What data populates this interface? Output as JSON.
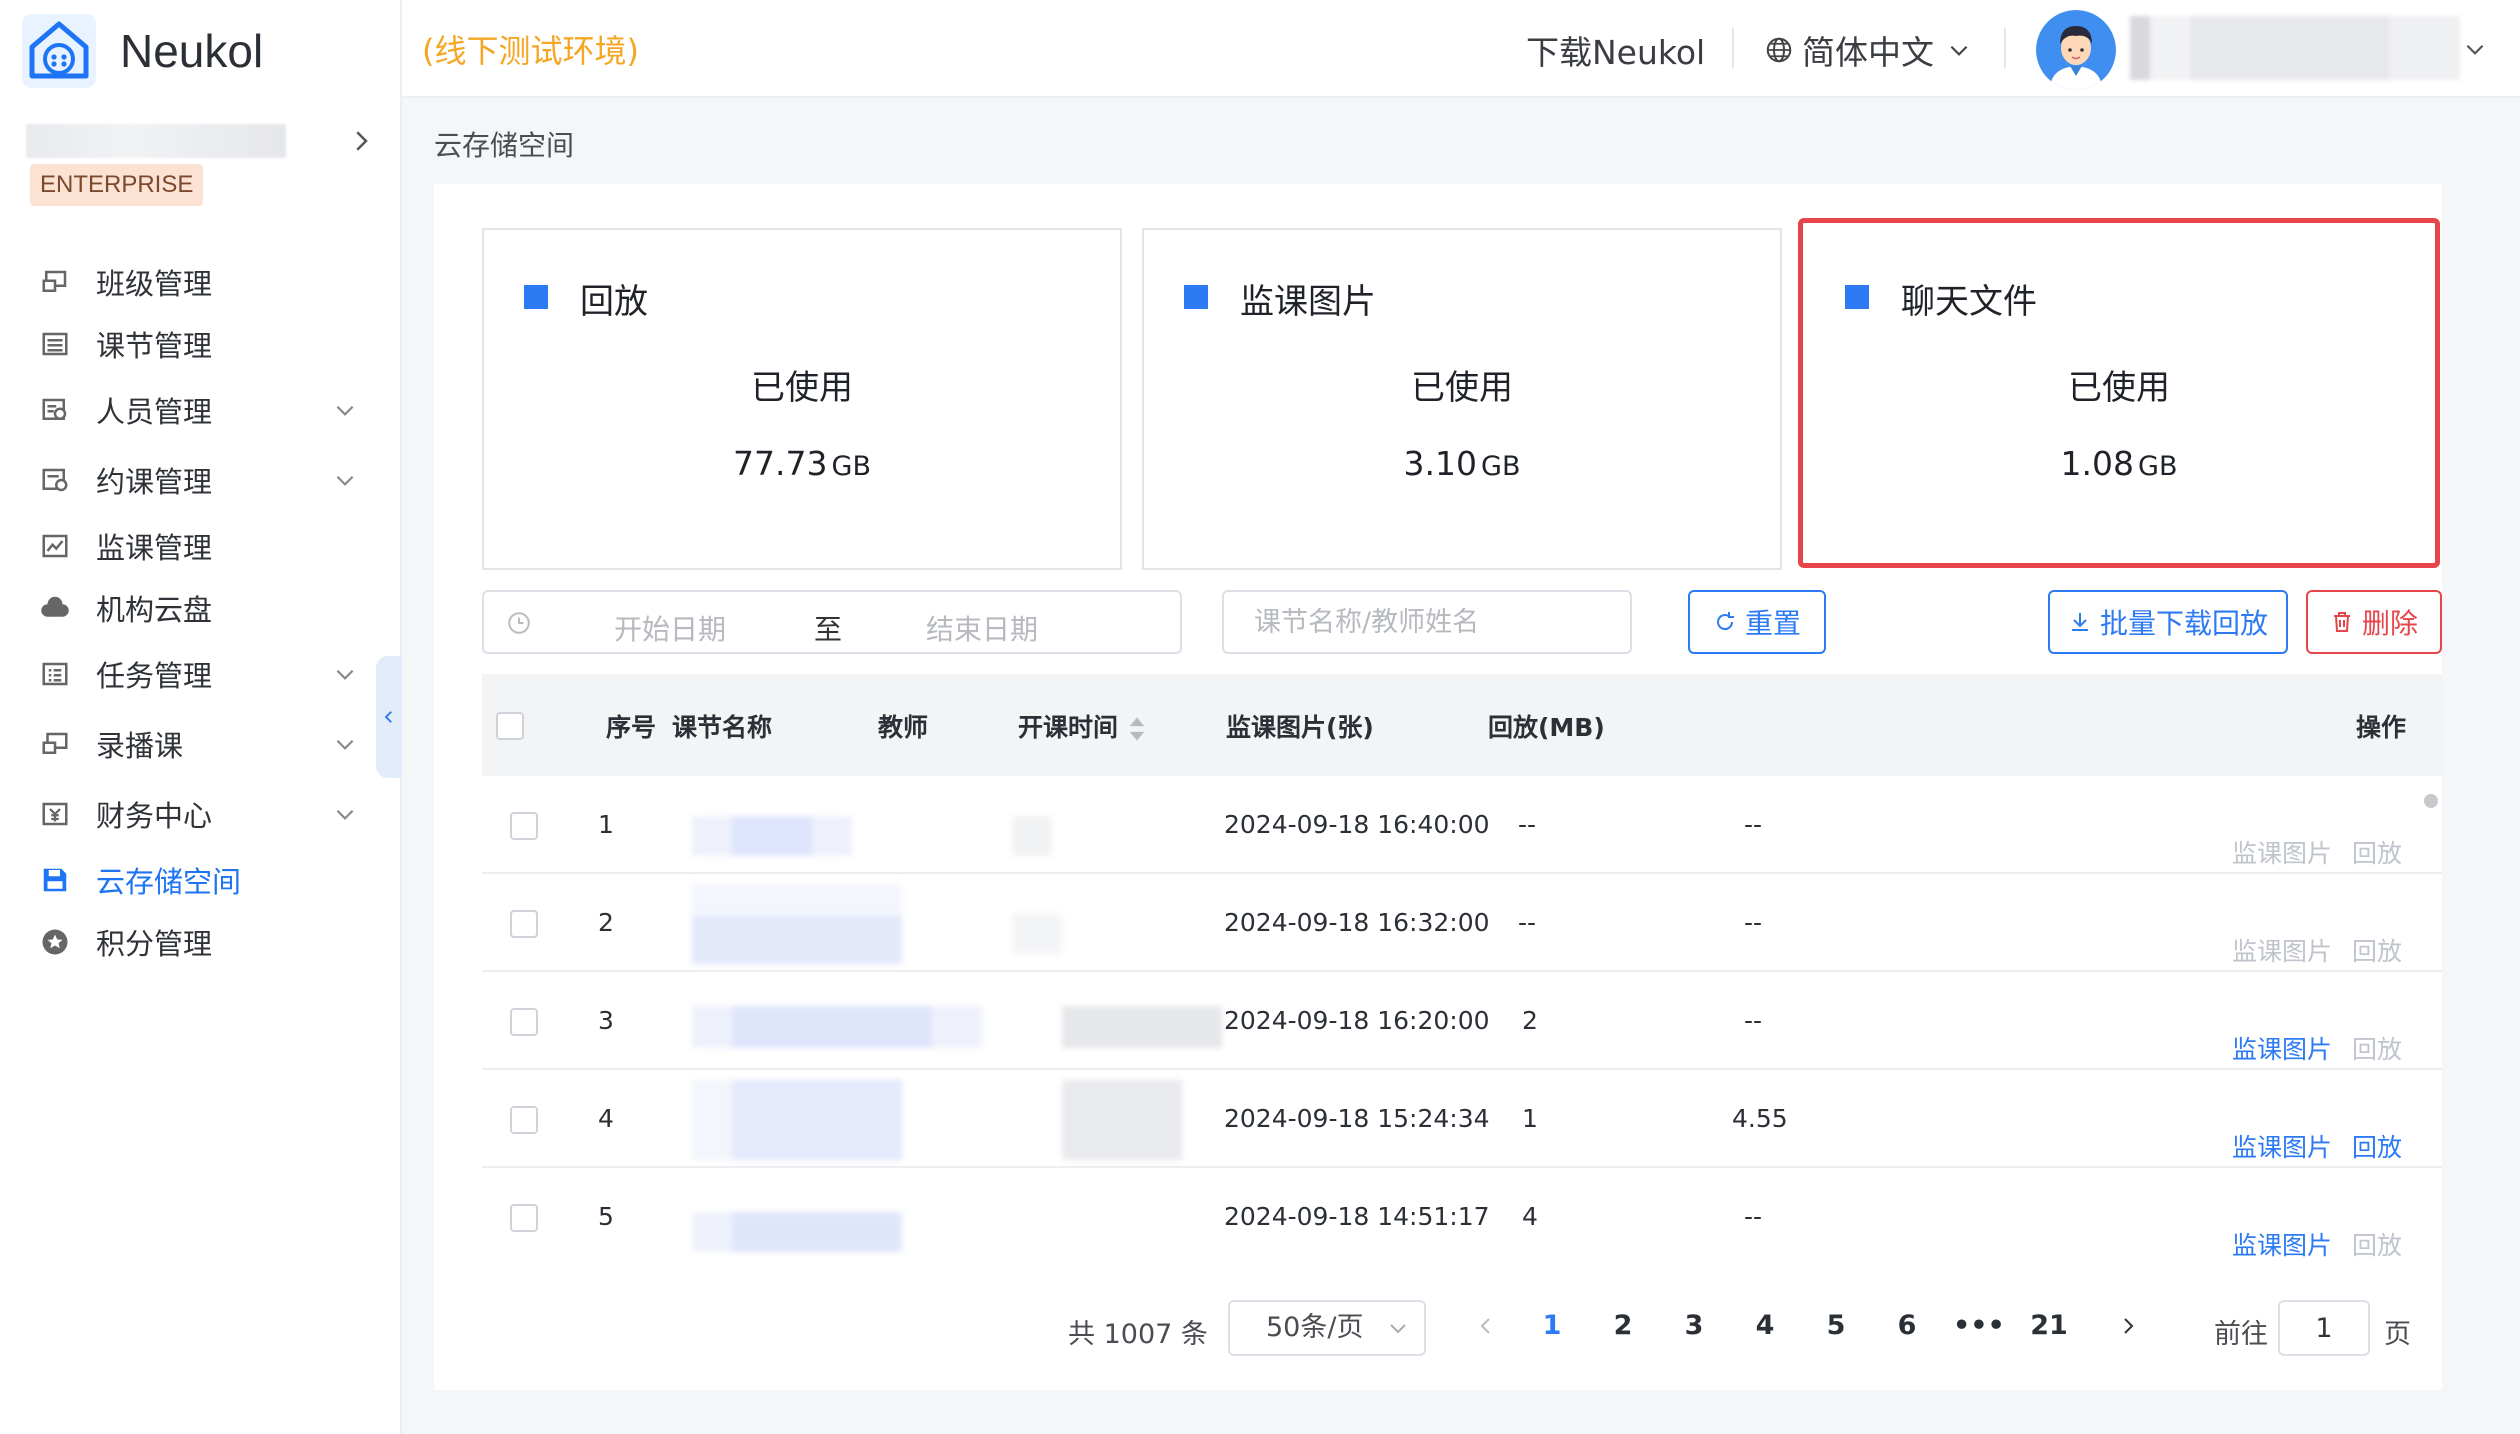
{
  "brand": {
    "name": "Neukol",
    "plan_badge": "ENTERPRISE"
  },
  "sidebar": {
    "items": [
      {
        "label": "班级管理",
        "icon": "class-icon",
        "expandable": false,
        "active": false
      },
      {
        "label": "课节管理",
        "icon": "lesson-list-icon",
        "expandable": false,
        "active": false
      },
      {
        "label": "人员管理",
        "icon": "people-icon",
        "expandable": true,
        "active": false
      },
      {
        "label": "约课管理",
        "icon": "booking-icon",
        "expandable": true,
        "active": false
      },
      {
        "label": "监课管理",
        "icon": "monitor-chart-icon",
        "expandable": false,
        "active": false
      },
      {
        "label": "机构云盘",
        "icon": "cloud-icon",
        "expandable": false,
        "active": false
      },
      {
        "label": "任务管理",
        "icon": "task-icon",
        "expandable": true,
        "active": false
      },
      {
        "label": "录播课",
        "icon": "recorded-class-icon",
        "expandable": true,
        "active": false
      },
      {
        "label": "财务中心",
        "icon": "yen-icon",
        "expandable": true,
        "active": false
      },
      {
        "label": "云存储空间",
        "icon": "save-icon",
        "expandable": false,
        "active": true
      },
      {
        "label": "积分管理",
        "icon": "points-icon",
        "expandable": false,
        "active": false
      }
    ]
  },
  "header": {
    "env_tag": "(线下测试环境)",
    "download_label": "下载Neukol",
    "language": "简体中文"
  },
  "breadcrumb": "云存储空间",
  "storage_cards": [
    {
      "title": "回放",
      "used_label": "已使用",
      "value": "77.73",
      "unit": "GB",
      "highlighted": false
    },
    {
      "title": "监课图片",
      "used_label": "已使用",
      "value": "3.10",
      "unit": "GB",
      "highlighted": false
    },
    {
      "title": "聊天文件",
      "used_label": "已使用",
      "value": "1.08",
      "unit": "GB",
      "highlighted": true
    }
  ],
  "filters": {
    "start_placeholder": "开始日期",
    "range_separator": "至",
    "end_placeholder": "结束日期",
    "search_placeholder": "课节名称/教师姓名",
    "reset_label": "重置",
    "batch_download_label": "批量下载回放",
    "delete_label": "删除"
  },
  "table": {
    "headers": {
      "index": "序号",
      "lesson_name": "课节名称",
      "teacher": "教师",
      "start_time": "开课时间",
      "monitor_images": "监课图片(张)",
      "playback": "回放(MB)",
      "actions": "操作"
    },
    "action_labels": {
      "monitor": "监课图片",
      "playback": "回放"
    },
    "rows": [
      {
        "index": "1",
        "start_time": "2024-09-18 16:40:00",
        "monitor_images": "--",
        "playback": "--",
        "monitor_enabled": false,
        "playback_enabled": false
      },
      {
        "index": "2",
        "start_time": "2024-09-18 16:32:00",
        "monitor_images": "--",
        "playback": "--",
        "monitor_enabled": false,
        "playback_enabled": false
      },
      {
        "index": "3",
        "start_time": "2024-09-18 16:20:00",
        "monitor_images": "2",
        "playback": "--",
        "monitor_enabled": true,
        "playback_enabled": false
      },
      {
        "index": "4",
        "start_time": "2024-09-18 15:24:34",
        "monitor_images": "1",
        "playback": "4.55",
        "monitor_enabled": true,
        "playback_enabled": true
      },
      {
        "index": "5",
        "start_time": "2024-09-18 14:51:17",
        "monitor_images": "4",
        "playback": "--",
        "monitor_enabled": true,
        "playback_enabled": false
      }
    ]
  },
  "pagination": {
    "total_label": "共 1007 条",
    "page_size": "50条/页",
    "pages": [
      "1",
      "2",
      "3",
      "4",
      "5",
      "6",
      "•••",
      "21"
    ],
    "current_page": "1",
    "goto_label": "前往",
    "goto_value": "1",
    "page_suffix": "页"
  },
  "colors": {
    "accent": "#2d7bf4",
    "danger": "#e6454a",
    "env_tag": "#f5a623",
    "active_menu": "#1d74f5"
  }
}
